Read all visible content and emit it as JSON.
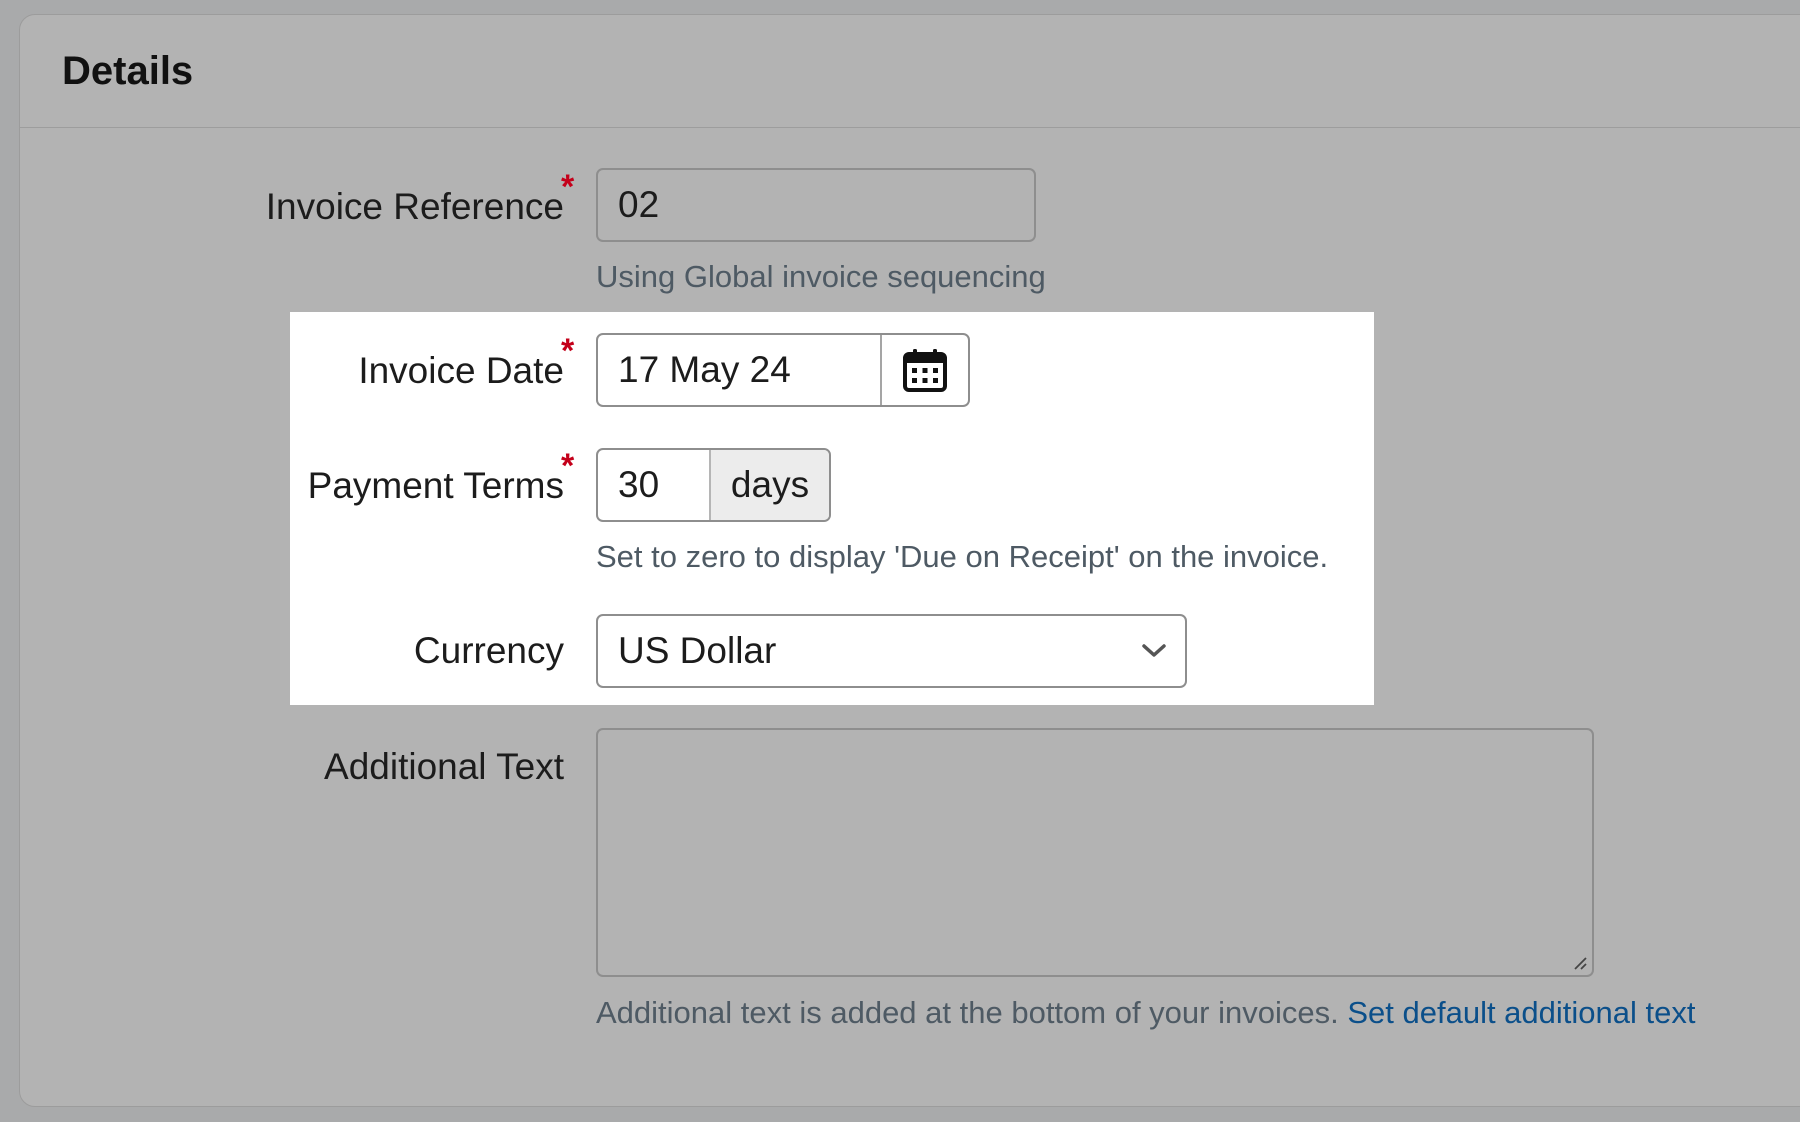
{
  "panel": {
    "title": "Details"
  },
  "invoice_reference": {
    "label": "Invoice Reference",
    "required_mark": "*",
    "value": "02",
    "help": "Using Global invoice sequencing"
  },
  "invoice_date": {
    "label": "Invoice Date",
    "required_mark": "*",
    "value": "17 May 24",
    "icon": "calendar-icon"
  },
  "payment_terms": {
    "label": "Payment Terms",
    "required_mark": "*",
    "value": "30",
    "unit": "days",
    "help": "Set to zero to display 'Due on Receipt' on the invoice."
  },
  "currency": {
    "label": "Currency",
    "selected": "US Dollar",
    "icon": "chevron-down-icon"
  },
  "additional_text": {
    "label": "Additional Text",
    "value": "",
    "help": "Additional text is added at the bottom of your invoices.",
    "link": "Set default additional text"
  },
  "colors": {
    "required": "#c4001a",
    "link": "#0b4f8a",
    "highlight": "#ffffff"
  }
}
